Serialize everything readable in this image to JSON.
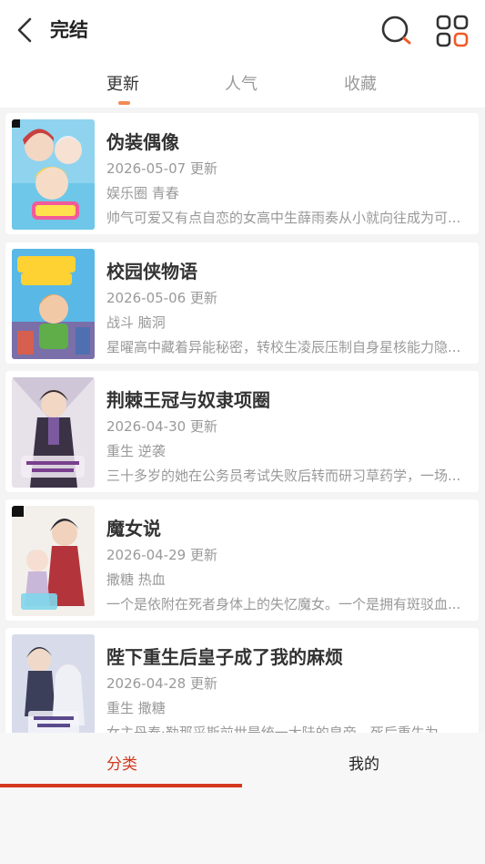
{
  "header": {
    "title": "完结",
    "back_icon": "chevron-left-icon",
    "search_icon": "search-icon",
    "grid_icon": "grid-icon"
  },
  "tabs": [
    {
      "label": "更新",
      "active": true
    },
    {
      "label": "人气",
      "active": false
    },
    {
      "label": "收藏",
      "active": false
    }
  ],
  "comics": [
    {
      "title": "伪装偶像",
      "date": "2026-05-07 更新",
      "tags": "娱乐圈 青春",
      "desc": "帅气可爱又有点自恋的女高中生薛雨奏从小就向往成为可..."
    },
    {
      "title": "校园侠物语",
      "date": "2026-05-06 更新",
      "tags": "战斗 脑洞",
      "desc": "星曜高中藏着异能秘密，转校生凌辰压制自身星核能力隐..."
    },
    {
      "title": "荆棘王冠与奴隶项圈",
      "date": "2026-04-30 更新",
      "tags": "重生 逆袭",
      "desc": "三十多岁的她在公务员考试失败后转而研习草药学，一场..."
    },
    {
      "title": "魔女说",
      "date": "2026-04-29 更新",
      "tags": "撒糖 热血",
      "desc": "一个是依附在死者身体上的失忆魔女。一个是拥有斑驳血..."
    },
    {
      "title": "陛下重生后皇子成了我的麻烦",
      "date": "2026-04-28 更新",
      "tags": "重生 撒糖",
      "desc": "女主丹泰·勒那采斯前世是统一大陆的皇帝，死后重生为..."
    }
  ],
  "bottom_nav": [
    {
      "label": "分类",
      "active": true
    },
    {
      "label": "我的",
      "active": false
    }
  ],
  "colors": {
    "accent": "#d4381e",
    "tab_indicator": "#f08a55"
  }
}
